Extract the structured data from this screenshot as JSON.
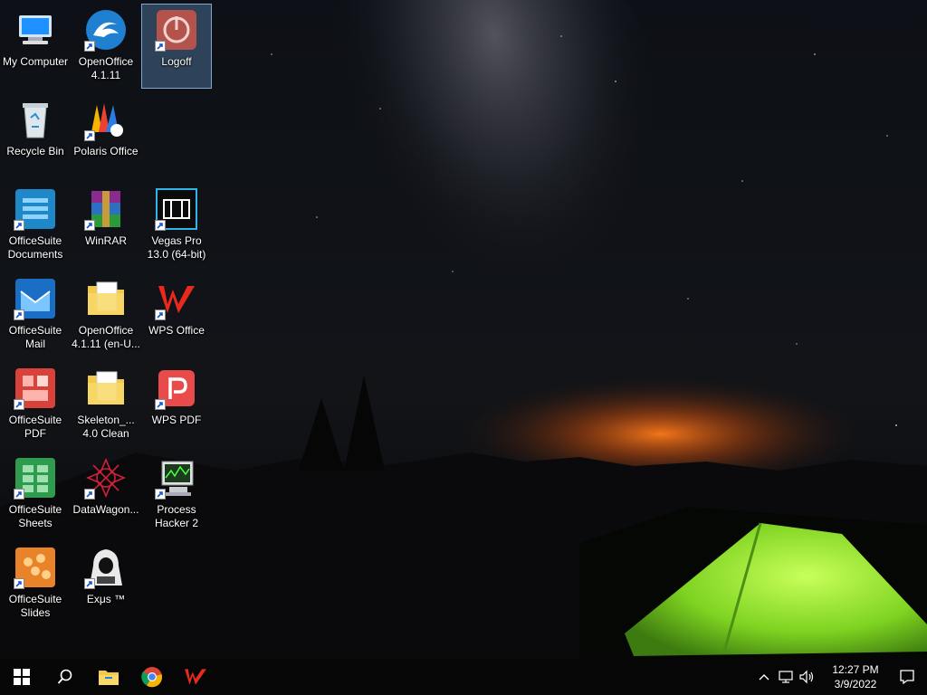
{
  "desktop": {
    "icons": [
      {
        "label": "My Computer",
        "icon": "my-computer-icon",
        "shortcut": false
      },
      {
        "label": "OpenOffice\n4.1.11",
        "icon": "openoffice-icon",
        "shortcut": true
      },
      {
        "label": "Logoff",
        "icon": "logoff-icon",
        "shortcut": true,
        "selected": true
      },
      {
        "label": "Recycle Bin",
        "icon": "recycle-bin-icon",
        "shortcut": false
      },
      {
        "label": "Polaris Office",
        "icon": "polaris-office-icon",
        "shortcut": true
      },
      {
        "label": "OfficeSuite\nDocuments",
        "icon": "officesuite-documents-icon",
        "shortcut": true
      },
      {
        "label": "WinRAR",
        "icon": "winrar-icon",
        "shortcut": true
      },
      {
        "label": "Vegas Pro\n13.0 (64-bit)",
        "icon": "vegas-pro-icon",
        "shortcut": true
      },
      {
        "label": "OfficeSuite\nMail",
        "icon": "officesuite-mail-icon",
        "shortcut": true
      },
      {
        "label": "OpenOffice\n4.1.11 (en-U...",
        "icon": "folder-openoffice-icon",
        "shortcut": false
      },
      {
        "label": "WPS Office",
        "icon": "wps-office-icon",
        "shortcut": true
      },
      {
        "label": "OfficeSuite\nPDF",
        "icon": "officesuite-pdf-icon",
        "shortcut": true
      },
      {
        "label": "Skeleton_...\n4.0 Clean",
        "icon": "folder-skeleton-icon",
        "shortcut": false
      },
      {
        "label": "WPS PDF",
        "icon": "wps-pdf-icon",
        "shortcut": true
      },
      {
        "label": "OfficeSuite\nSheets",
        "icon": "officesuite-sheets-icon",
        "shortcut": true
      },
      {
        "label": "DataWagon...",
        "icon": "datawagon-icon",
        "shortcut": true
      },
      {
        "label": "Process\nHacker 2",
        "icon": "process-hacker-icon",
        "shortcut": true
      },
      {
        "label": "OfficeSuite\nSlides",
        "icon": "officesuite-slides-icon",
        "shortcut": true
      },
      {
        "label": "Exμs ™",
        "icon": "exus-icon",
        "shortcut": true
      }
    ]
  },
  "taskbar": {
    "start": "windows-start-icon",
    "search": "search-icon",
    "pinned": [
      {
        "name": "file-explorer-icon"
      },
      {
        "name": "chrome-icon"
      },
      {
        "name": "wps-office-taskbar-icon"
      }
    ],
    "tray": {
      "icons": [
        "chevron-up-icon",
        "network-icon",
        "volume-icon"
      ],
      "time": "12:27 PM",
      "date": "3/9/2022",
      "notification": "notification-icon"
    }
  }
}
